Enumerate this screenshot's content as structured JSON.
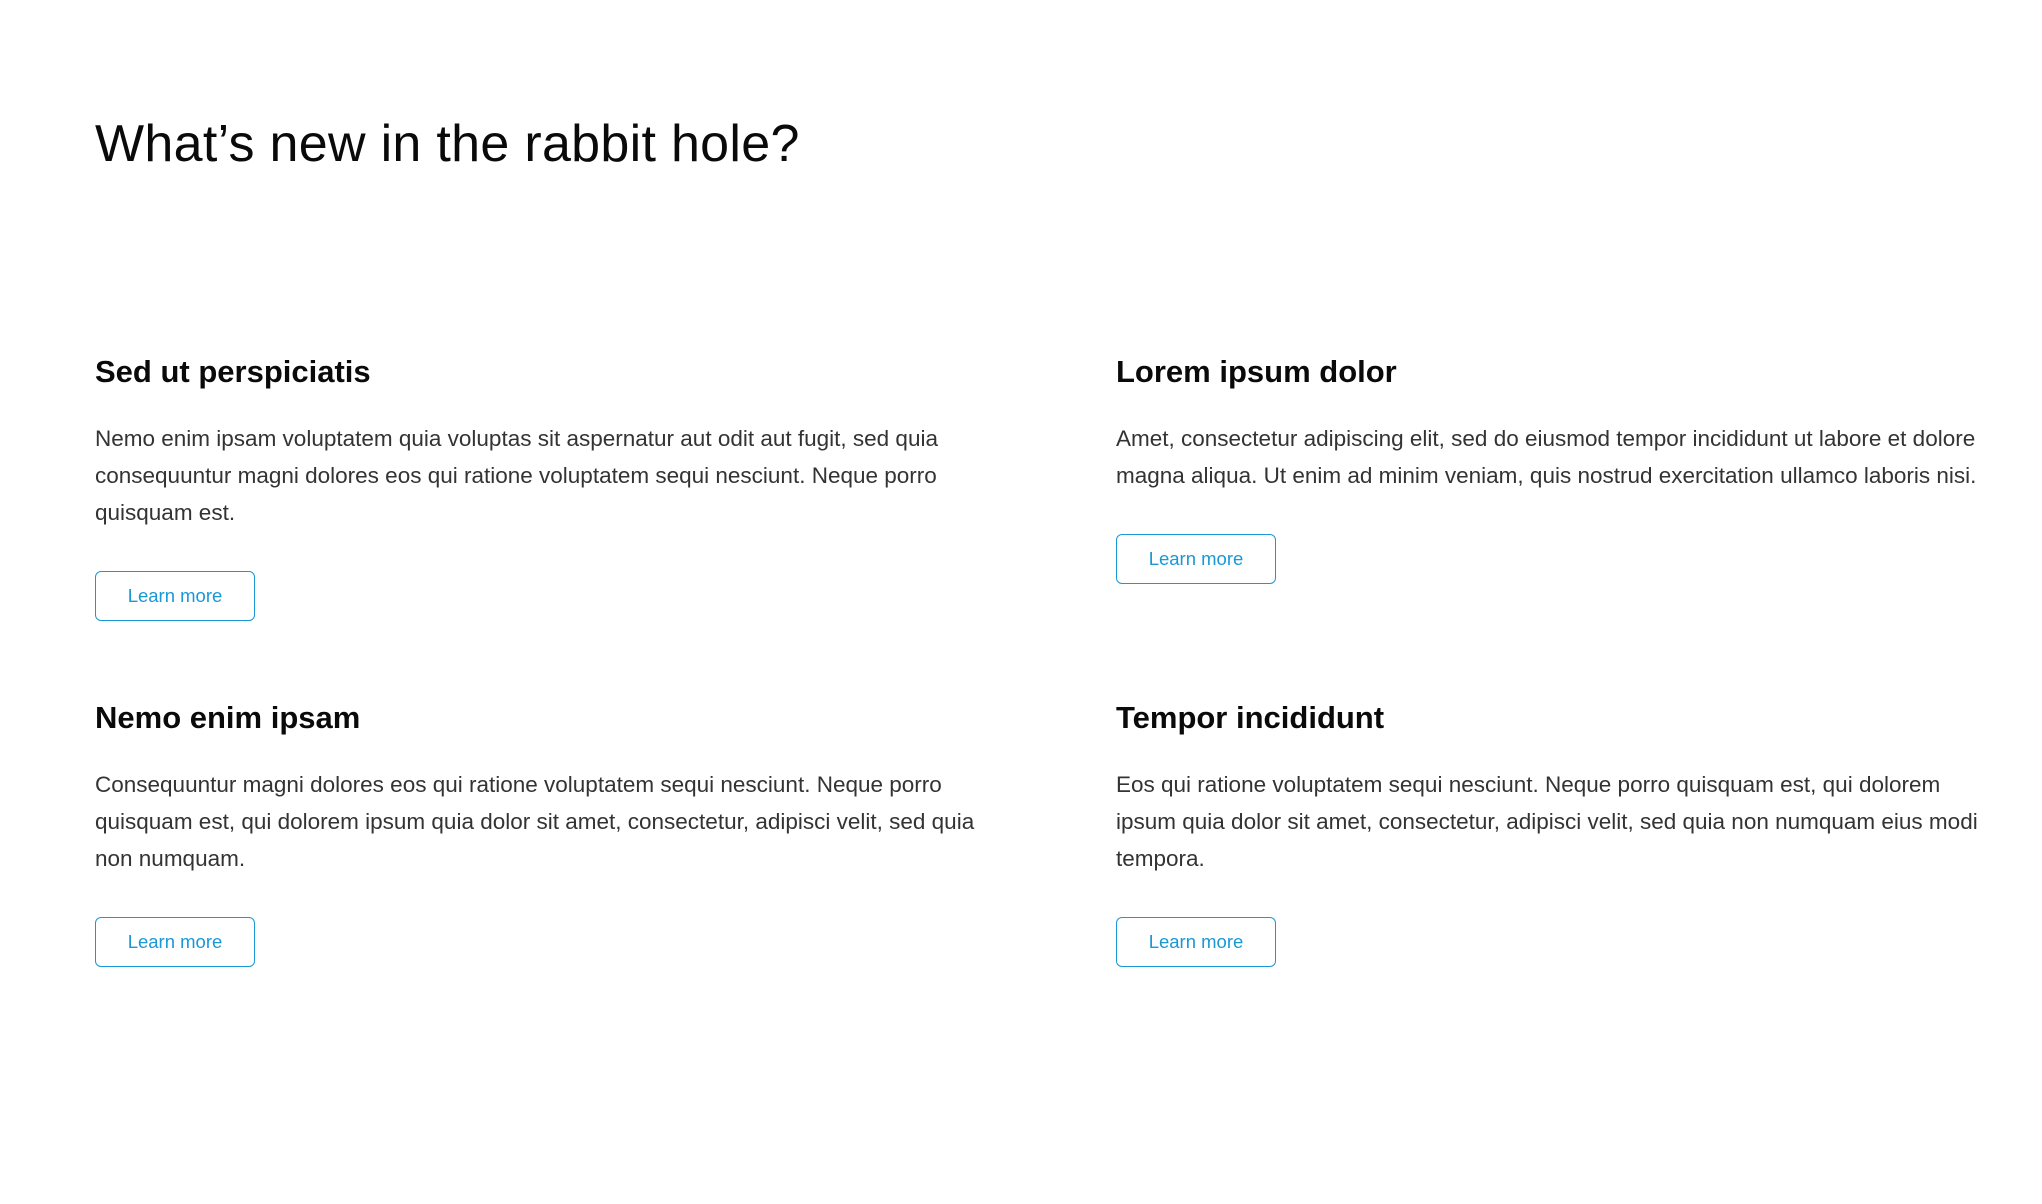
{
  "page": {
    "title": "What’s new in the rabbit hole?"
  },
  "cards": [
    {
      "title": "Sed ut perspiciatis",
      "body": "Nemo enim ipsam voluptatem quia voluptas sit aspernatur aut odit aut fugit, sed quia consequuntur magni dolores eos qui ratione voluptatem sequi nesciunt. Neque porro quisquam est.",
      "button_label": "Learn more"
    },
    {
      "title": "Lorem ipsum dolor",
      "body": "Amet, consectetur adipiscing elit, sed do eiusmod tempor incididunt ut labore et dolore magna aliqua. Ut enim ad minim veniam, quis nostrud exercitation ullamco laboris nisi.",
      "button_label": "Learn more"
    },
    {
      "title": "Nemo enim ipsam",
      "body": "Consequuntur magni dolores eos qui ratione voluptatem sequi nesciunt. Neque porro quisquam est, qui dolorem ipsum quia dolor sit amet, consectetur, adipisci velit, sed quia non numquam.",
      "button_label": "Learn more"
    },
    {
      "title": "Tempor incididunt",
      "body": "Eos qui ratione voluptatem sequi nesciunt. Neque porro quisquam est, qui dolorem ipsum quia dolor sit amet, consectetur, adipisci velit, sed quia non numquam eius modi tempora.",
      "button_label": "Learn more"
    }
  ],
  "colors": {
    "accent": "#1a98d5",
    "heading": "#0a0a0a",
    "body_text": "#333333",
    "background": "#ffffff"
  }
}
